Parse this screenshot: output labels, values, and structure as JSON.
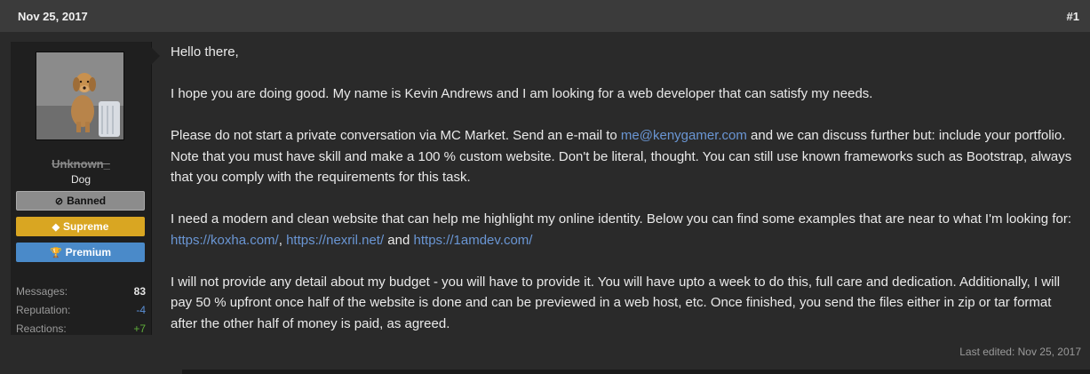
{
  "header": {
    "date": "Nov 25, 2017",
    "post_number": "#1"
  },
  "user": {
    "avatar_icon": "dog-photo",
    "name": "Unknown_",
    "title": "Dog",
    "banners": {
      "banned": {
        "icon": "ban-icon",
        "glyph": "⊘",
        "label": "Banned"
      },
      "supreme": {
        "icon": "diamond-icon",
        "glyph": "◆",
        "label": "Supreme",
        "color": "#d9a622"
      },
      "premium": {
        "icon": "trophy-icon",
        "glyph": "🏆",
        "label": "Premium",
        "color": "#4a8ac9"
      }
    },
    "stats": [
      {
        "label": "Messages:",
        "value": "83"
      },
      {
        "label": "Reputation:",
        "value": "-4"
      },
      {
        "label": "Reactions:",
        "value": "+7"
      }
    ]
  },
  "message": {
    "p1": "Hello there,",
    "p2": "I hope you are doing good. My name is Kevin Andrews and I am looking for a web developer that can satisfy my needs.",
    "p3_a": "Please do not start a private conversation via MC Market. Send an e-mail to ",
    "p3_email": "me@kenygamer.com",
    "p3_b": " and we can discuss further but: include your portfolio. Note that you must have skill and make a 100 % custom website. Don't be literal, thought. You can still use known frameworks such as Bootstrap, always that you comply with the requirements for this task.",
    "p4_a": "I need a modern and clean website that can help me highlight my online identity. Below you can find some examples that are near to what I'm looking for: ",
    "p4_link1": "https://koxha.com/",
    "p4_sep1": ", ",
    "p4_link2": "https://nexril.net/",
    "p4_sep2": " and ",
    "p4_link3": "https://1amdev.com/",
    "p5": "I will not provide any detail about my budget - you will have to provide it. You will have upto a week to do this, full care and dedication. Additionally, I will pay 50 % upfront once half of the website is done and can be previewed in a web host, etc. Once finished, you send the files either in zip or tar format after the other half of money is paid, as agreed."
  },
  "last_edited": "Last edited: Nov 25, 2017",
  "colors": {
    "link": "#6a96d4",
    "reputation_negative": "#5a8fd6",
    "reactions_positive": "#5fae3a"
  }
}
